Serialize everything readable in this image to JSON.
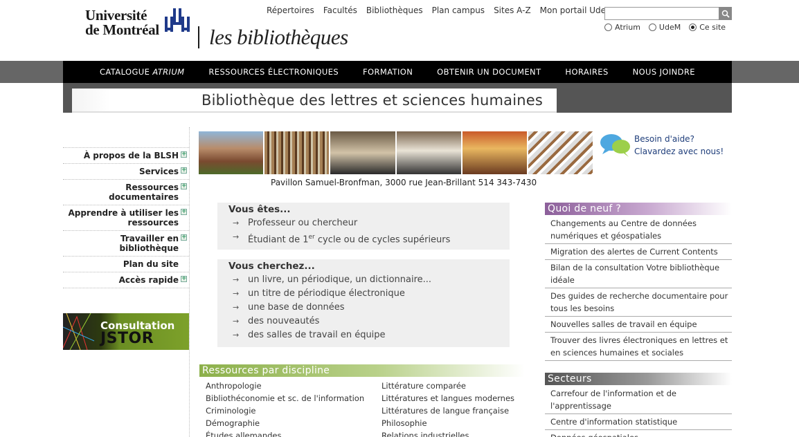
{
  "header": {
    "logo_line1": "Université",
    "logo_line2": "de Montréal",
    "logo_lib": "les bibliothèques",
    "toplinks": [
      "Répertoires",
      "Facultés",
      "Bibliothèques",
      "Plan campus",
      "Sites A-Z",
      "Mon portail UdeM"
    ],
    "search": {
      "value": "",
      "scopes": [
        "Atrium",
        "UdeM",
        "Ce site"
      ],
      "selected": "Ce site"
    }
  },
  "nav": {
    "catalogue_prefix": "CATALOGUE ",
    "catalogue_italic": "ATRIUM",
    "items": [
      "RESSOURCES ÉLECTRONIQUES",
      "FORMATION",
      "OBTENIR UN DOCUMENT",
      "HORAIRES",
      "NOUS JOINDRE"
    ]
  },
  "page_title": "Bibliothèque des lettres et sciences humaines",
  "sidebar": {
    "items": [
      {
        "label": "À propos de la BLSH",
        "expand": true
      },
      {
        "label": "Services",
        "expand": true
      },
      {
        "label": "Ressources documentaires",
        "expand": true
      },
      {
        "label": "Apprendre à utiliser les ressources",
        "expand": true
      },
      {
        "label": "Travailler en bibliothèque",
        "expand": true
      },
      {
        "label": "Plan du site",
        "expand": false
      },
      {
        "label": "Accès rapide",
        "expand": true
      }
    ],
    "jstor_line1": "Consultation",
    "jstor_line2": "JSTOR"
  },
  "photo_caption": "Pavillon Samuel-Bronfman, 3000 rue Jean-Brillant 514 343-7430",
  "help": {
    "line1": "Besoin d'aide?",
    "line2": "Clavardez avec nous!"
  },
  "vous_etes": {
    "title": "Vous êtes...",
    "item1": "Professeur ou chercheur",
    "item2_prefix": "Étudiant de 1",
    "item2_sup": "er",
    "item2_suffix": " cycle ou de cycles supérieurs"
  },
  "vous_cherchez": {
    "title": "Vous cherchez...",
    "items": [
      "un livre, un périodique, un dictionnaire...",
      "un titre de périodique électronique",
      "une base de données",
      "des nouveautés",
      "des salles de travail en équipe"
    ]
  },
  "disciplines": {
    "title": "Ressources par discipline",
    "col1": [
      "Anthropologie",
      "Bibliothéconomie et sc. de l'information",
      "Criminologie",
      "Démographie",
      "Études allemandes"
    ],
    "col2": [
      "Littérature comparée",
      "Littératures et langues modernes",
      "Littératures de langue française",
      "Philosophie",
      "Relations industrielles"
    ]
  },
  "news": {
    "title": "Quoi de neuf ?",
    "items": [
      "Changements au Centre de données numériques et géospatiales",
      "Migration des alertes de Current Contents",
      "Bilan de la consultation Votre bibliothèque idéale",
      "Des guides de recherche documentaire pour tous les besoins",
      "Nouvelles salles de travail en équipe",
      "Trouver des livres électroniques en lettres et en sciences humaines et sociales"
    ]
  },
  "secteurs": {
    "title": "Secteurs",
    "items": [
      "Carrefour de l'information et de l'apprentissage",
      "Centre d'information statistique",
      "Données géospatiales"
    ]
  }
}
